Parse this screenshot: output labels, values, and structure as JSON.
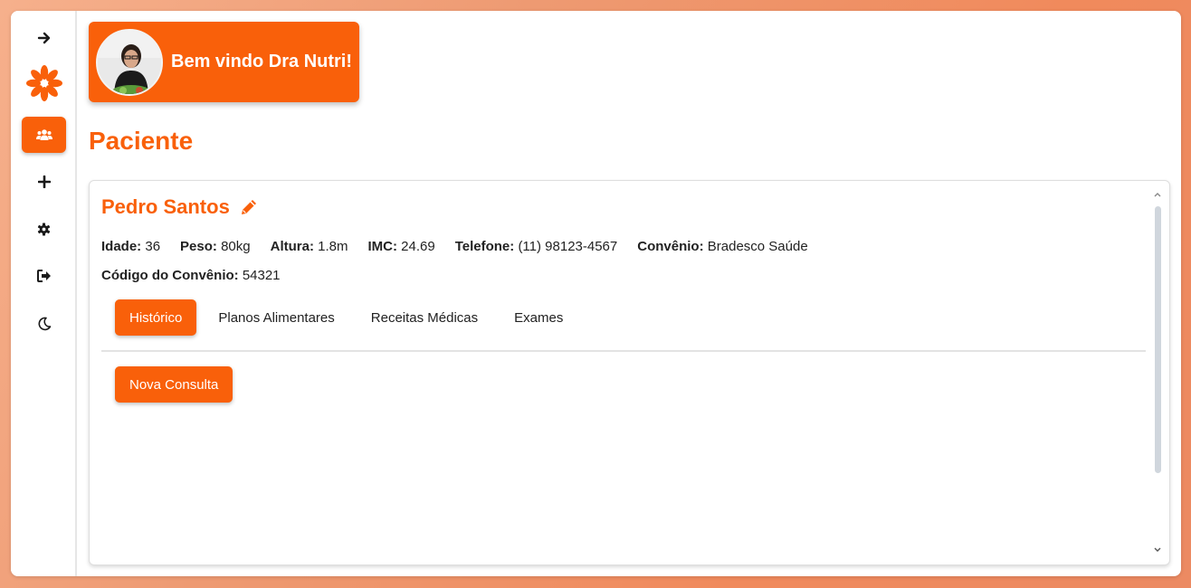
{
  "sidebar": {
    "items": [
      {
        "icon": "arrow-right-icon"
      },
      {
        "icon": "logo-icon"
      },
      {
        "icon": "users-icon",
        "active": true
      },
      {
        "icon": "plus-icon"
      },
      {
        "icon": "gear-icon"
      },
      {
        "icon": "sign-out-icon"
      },
      {
        "icon": "moon-icon"
      }
    ]
  },
  "header": {
    "welcome_text": "Bem vindo Dra Nutri!"
  },
  "page": {
    "title": "Paciente"
  },
  "patient": {
    "name": "Pedro Santos",
    "idade_label": "Idade:",
    "idade": "36",
    "peso_label": "Peso:",
    "peso": "80kg",
    "altura_label": "Altura:",
    "altura": "1.8m",
    "imc_label": "IMC:",
    "imc": "24.69",
    "telefone_label": "Telefone:",
    "telefone": "(11) 98123-4567",
    "convenio_label": "Convênio:",
    "convenio": "Bradesco Saúde",
    "codigo_label": "Código do Convênio:",
    "codigo": "54321"
  },
  "tabs": [
    {
      "label": "Histórico",
      "active": true
    },
    {
      "label": "Planos Alimentares"
    },
    {
      "label": "Receitas Médicas"
    },
    {
      "label": "Exames"
    }
  ],
  "actions": {
    "new_consult": "Nova Consulta"
  },
  "colors": {
    "accent": "#f9600a"
  }
}
